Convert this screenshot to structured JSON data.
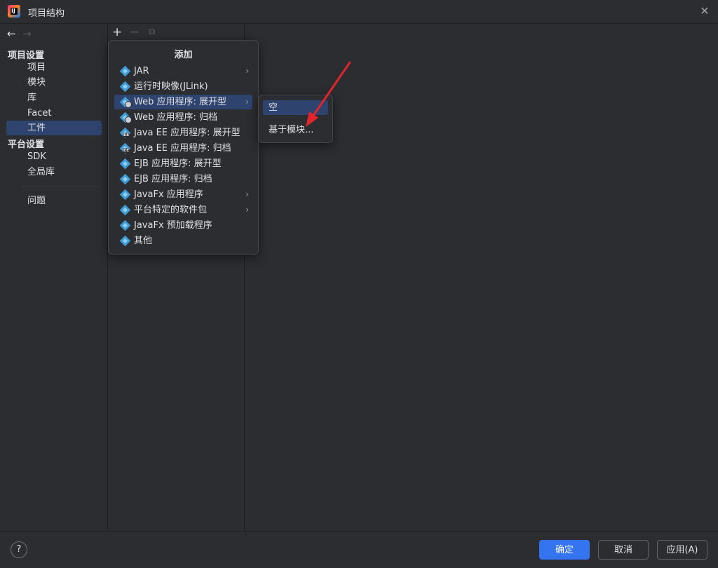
{
  "window": {
    "title": "项目结构",
    "close_icon": "close-icon"
  },
  "sidebar": {
    "project_settings_heading": "项目设置",
    "project_items": [
      {
        "label": "项目"
      },
      {
        "label": "模块"
      },
      {
        "label": "库"
      },
      {
        "label": "Facet"
      },
      {
        "label": "工件",
        "selected": true
      }
    ],
    "platform_settings_heading": "平台设置",
    "platform_items": [
      {
        "label": "SDK"
      },
      {
        "label": "全局库"
      }
    ],
    "problems_label": "问题"
  },
  "add_popup": {
    "title": "添加",
    "items": [
      {
        "label": "JAR",
        "submenu": true,
        "icon": "artifact-icon"
      },
      {
        "label": "运行时映像(JLink)",
        "icon": "artifact-icon"
      },
      {
        "label": "Web 应用程序: 展开型",
        "submenu": true,
        "selected": true,
        "icon": "web-artifact-icon"
      },
      {
        "label": "Web 应用程序: 归档",
        "icon": "web-artifact-icon"
      },
      {
        "label": "Java EE 应用程序: 展开型",
        "icon": "javaee-artifact-icon"
      },
      {
        "label": "Java EE 应用程序: 归档",
        "icon": "javaee-artifact-icon"
      },
      {
        "label": "EJB 应用程序: 展开型",
        "icon": "ejb-artifact-icon"
      },
      {
        "label": "EJB 应用程序: 归档",
        "icon": "ejb-artifact-icon"
      },
      {
        "label": "JavaFx 应用程序",
        "submenu": true,
        "icon": "artifact-icon"
      },
      {
        "label": "平台特定的软件包",
        "submenu": true,
        "icon": "artifact-icon"
      },
      {
        "label": "JavaFx 预加载程序",
        "icon": "artifact-icon"
      },
      {
        "label": "其他",
        "icon": "artifact-icon"
      }
    ]
  },
  "submenu": {
    "items": [
      {
        "label": "空",
        "selected": true
      },
      {
        "label": "基于模块..."
      }
    ]
  },
  "footer": {
    "help_label": "?",
    "ok_label": "确定",
    "cancel_label": "取消",
    "apply_label": "应用(A)"
  },
  "colors": {
    "background": "#2b2d30",
    "selection": "#2e436e",
    "primary_button": "#3574f0",
    "annotation_arrow": "#e0252b"
  }
}
